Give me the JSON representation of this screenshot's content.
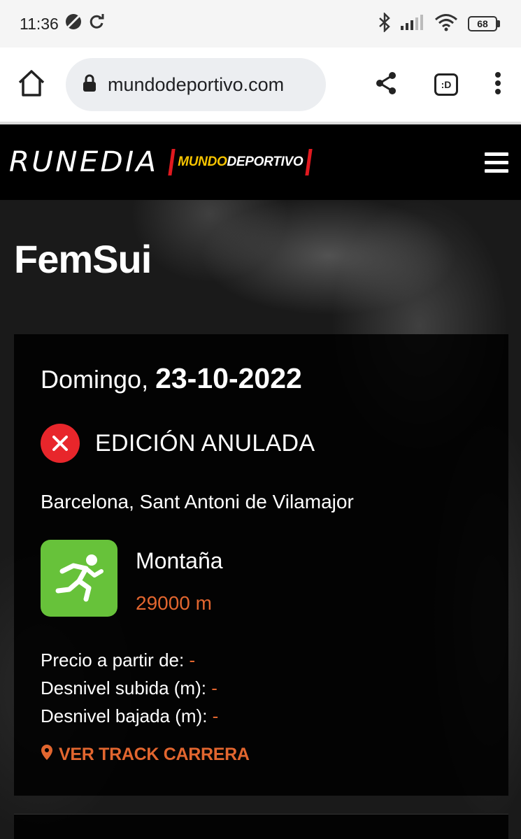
{
  "status_bar": {
    "time": "11:36",
    "battery": "68"
  },
  "browser": {
    "url": "mundodeportivo.com",
    "tab_label": ":D"
  },
  "site": {
    "brand": "RUNEDIA",
    "partner_part1": "MUNDO",
    "partner_part2": "DEPORTIVO"
  },
  "event": {
    "title": "FemSui",
    "day_label": "Domingo,",
    "date": "23-10-2022",
    "status": "EDICIÓN ANULADA",
    "location": "Barcelona, Sant Antoni de Vilamajor",
    "sport_type": "Montaña",
    "distance": "29000 m",
    "price_label": "Precio a partir de:",
    "price_value": "-",
    "ascent_label": "Desnivel subida (m):",
    "ascent_value": "-",
    "descent_label": "Desnivel bajada (m):",
    "descent_value": "-",
    "track_link": "VER TRACK CARRERA"
  },
  "colors": {
    "accent": "#e2662f",
    "cancel_red": "#e8262b",
    "sport_green": "#67c23a",
    "md_yellow": "#f6c400"
  }
}
